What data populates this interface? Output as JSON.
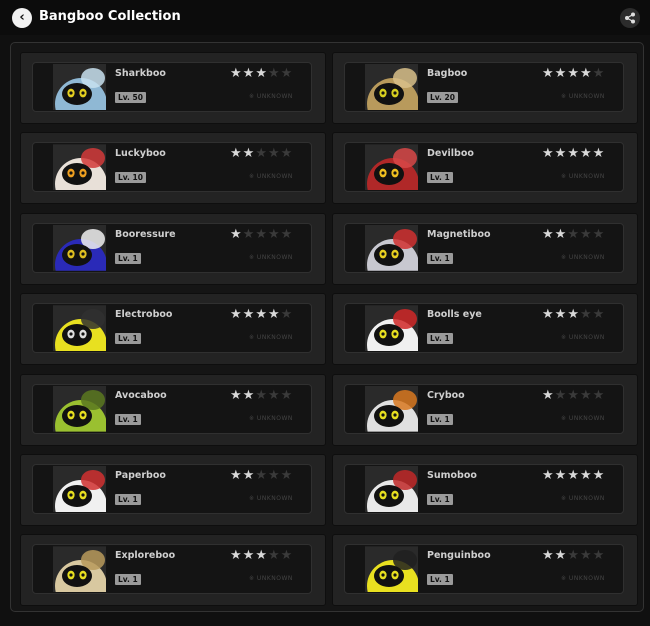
{
  "header": {
    "title": "Bangboo Collection",
    "back_icon": "chevron-left-icon",
    "share_icon": "share-icon"
  },
  "bangboos": [
    {
      "name": "Sharkboo",
      "level": "Lv. 50",
      "stars": 3,
      "max_stars": 5,
      "tag": "※ UNKNOWN",
      "portrait": {
        "body": "#8fb8d4",
        "accent": "#c8e0ee",
        "eye": "#e5d020"
      }
    },
    {
      "name": "Bagboo",
      "level": "Lv. 20",
      "stars": 4,
      "max_stars": 5,
      "tag": "※ UNKNOWN",
      "portrait": {
        "body": "#b89a5c",
        "accent": "#d8c08a",
        "eye": "#d8d020"
      }
    },
    {
      "name": "Luckyboo",
      "level": "Lv. 10",
      "stars": 2,
      "max_stars": 5,
      "tag": "※ UNKNOWN",
      "portrait": {
        "body": "#e8e0d8",
        "accent": "#d23a3a",
        "eye": "#f0a020"
      }
    },
    {
      "name": "Devilboo",
      "level": "Lv. 1",
      "stars": 5,
      "max_stars": 5,
      "tag": "※ UNKNOWN",
      "portrait": {
        "body": "#b02828",
        "accent": "#d84848",
        "eye": "#f0c020"
      }
    },
    {
      "name": "Booressure",
      "level": "Lv. 1",
      "stars": 1,
      "max_stars": 5,
      "tag": "※ UNKNOWN",
      "portrait": {
        "body": "#2a2ab8",
        "accent": "#f0f0f0",
        "eye": "#e0c020"
      }
    },
    {
      "name": "Magnetiboo",
      "level": "Lv. 1",
      "stars": 2,
      "max_stars": 5,
      "tag": "※ UNKNOWN",
      "portrait": {
        "body": "#c8c8d0",
        "accent": "#d03030",
        "eye": "#e8d020"
      }
    },
    {
      "name": "Electroboo",
      "level": "Lv. 1",
      "stars": 4,
      "max_stars": 5,
      "tag": "※ UNKNOWN",
      "portrait": {
        "body": "#e8e020",
        "accent": "#303030",
        "eye": "#e0e0e0"
      }
    },
    {
      "name": "Boolls eye",
      "level": "Lv. 1",
      "stars": 3,
      "max_stars": 5,
      "tag": "※ UNKNOWN",
      "portrait": {
        "body": "#f0f0f0",
        "accent": "#d02828",
        "eye": "#e8e020"
      }
    },
    {
      "name": "Avocaboo",
      "level": "Lv. 1",
      "stars": 2,
      "max_stars": 5,
      "tag": "※ UNKNOWN",
      "portrait": {
        "body": "#9ac030",
        "accent": "#5a7820",
        "eye": "#e8e020"
      }
    },
    {
      "name": "Cryboo",
      "level": "Lv. 1",
      "stars": 1,
      "max_stars": 5,
      "tag": "※ UNKNOWN",
      "portrait": {
        "body": "#e0e0e0",
        "accent": "#d87820",
        "eye": "#e8e020"
      }
    },
    {
      "name": "Paperboo",
      "level": "Lv. 1",
      "stars": 2,
      "max_stars": 5,
      "tag": "※ UNKNOWN",
      "portrait": {
        "body": "#f0f0f0",
        "accent": "#d03030",
        "eye": "#e8e020"
      }
    },
    {
      "name": "Sumoboo",
      "level": "Lv. 1",
      "stars": 5,
      "max_stars": 5,
      "tag": "※ UNKNOWN",
      "portrait": {
        "body": "#e8e8e8",
        "accent": "#c02828",
        "eye": "#e8e020"
      }
    },
    {
      "name": "Exploreboo",
      "level": "Lv. 1",
      "stars": 3,
      "max_stars": 5,
      "tag": "※ UNKNOWN",
      "portrait": {
        "body": "#d8c8a0",
        "accent": "#b89a5c",
        "eye": "#e8e020"
      }
    },
    {
      "name": "Penguinboo",
      "level": "Lv. 1",
      "stars": 2,
      "max_stars": 5,
      "tag": "※ UNKNOWN",
      "portrait": {
        "body": "#e8e020",
        "accent": "#202020",
        "eye": "#e8e020"
      }
    }
  ]
}
